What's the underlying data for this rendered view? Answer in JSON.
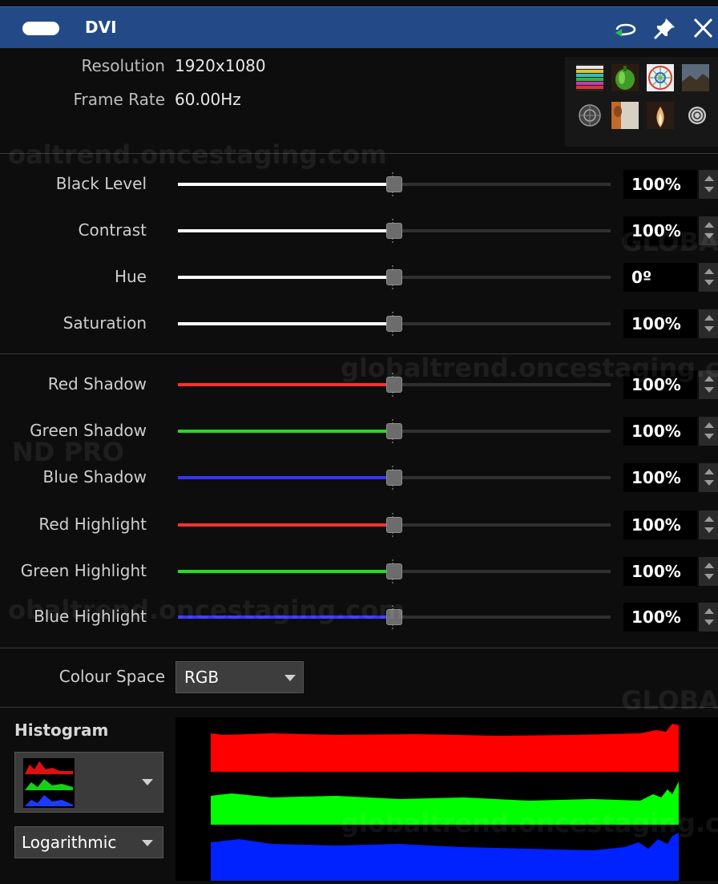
{
  "window": {
    "title": "DVI",
    "icons": [
      "refresh-loop-icon",
      "pin-icon",
      "close-icon"
    ]
  },
  "info": {
    "resolution_label": "Resolution",
    "resolution_value": "1920x1080",
    "frame_rate_label": "Frame Rate",
    "frame_rate_value": "60.00Hz"
  },
  "test_patterns": [
    "color-bars-pattern",
    "pepper-image-pattern",
    "color-wheel-pattern",
    "landscape-image-pattern",
    "circle-test-pattern",
    "portrait-image-pattern",
    "flame-image-pattern",
    "zone-plate-pattern"
  ],
  "adjustments": [
    {
      "label": "Black Level",
      "value": "100%",
      "level": 0.5,
      "color": "#ffffff"
    },
    {
      "label": "Contrast",
      "value": "100%",
      "level": 0.5,
      "color": "#ffffff"
    },
    {
      "label": "Hue",
      "value": "0º",
      "level": 0.5,
      "color": "#ffffff"
    },
    {
      "label": "Saturation",
      "value": "100%",
      "level": 0.5,
      "color": "#ffffff"
    }
  ],
  "color_adjustments": [
    {
      "label": "Red Shadow",
      "value": "100%",
      "level": 0.5,
      "color": "#ff3030"
    },
    {
      "label": "Green Shadow",
      "value": "100%",
      "level": 0.5,
      "color": "#22dd22"
    },
    {
      "label": "Blue Shadow",
      "value": "100%",
      "level": 0.5,
      "color": "#3535ff"
    },
    {
      "label": "Red Highlight",
      "value": "100%",
      "level": 0.5,
      "color": "#ff3030"
    },
    {
      "label": "Green Highlight",
      "value": "100%",
      "level": 0.5,
      "color": "#22dd22"
    },
    {
      "label": "Blue Highlight",
      "value": "100%",
      "level": 0.5,
      "color": "#3535ff"
    }
  ],
  "colour_space": {
    "label": "Colour Space",
    "value": "RGB"
  },
  "histogram": {
    "title": "Histogram",
    "mode_icon": "rgb-histogram-icon",
    "scale": "Logarithmic",
    "channel_colors": [
      "#ff0000",
      "#00ff00",
      "#0000ff"
    ]
  },
  "watermark": {
    "url": "globaltrend.oncestaging.com",
    "brand": "GLOBALTREND PRO"
  }
}
